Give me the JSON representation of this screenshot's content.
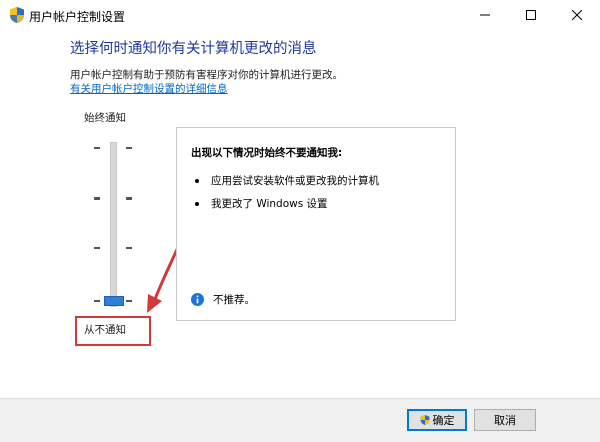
{
  "window": {
    "title": "用户帐户控制设置",
    "icon": "uac-shield-icon",
    "controls": {
      "minimize": "minimize-icon",
      "maximize": "maximize-icon",
      "close": "close-icon"
    }
  },
  "header": {
    "heading": "选择何时通知你有关计算机更改的消息",
    "description": "用户帐户控制有助于预防有害程序对你的计算机进行更改。",
    "link": "有关用户帐户控制设置的详细信息"
  },
  "slider": {
    "top_label": "始终通知",
    "bottom_label": "从不通知",
    "levels": 4,
    "selected_level": 1,
    "bottom_label_highlight_color": "#d23a3a"
  },
  "panel": {
    "title": "出现以下情况时始终不要通知我:",
    "bullets": [
      "应用尝试安装软件或更改我的计算机",
      "我更改了 Windows 设置"
    ],
    "note_icon": "info-icon",
    "note": "不推荐。"
  },
  "annotation": {
    "color": "#d23a3a"
  },
  "footer": {
    "ok_label": "确定",
    "ok_icon": "uac-shield-icon",
    "cancel_label": "取消"
  },
  "colors": {
    "accent": "#0078d7",
    "heading": "#1f3a9f",
    "link": "#0066cc"
  }
}
